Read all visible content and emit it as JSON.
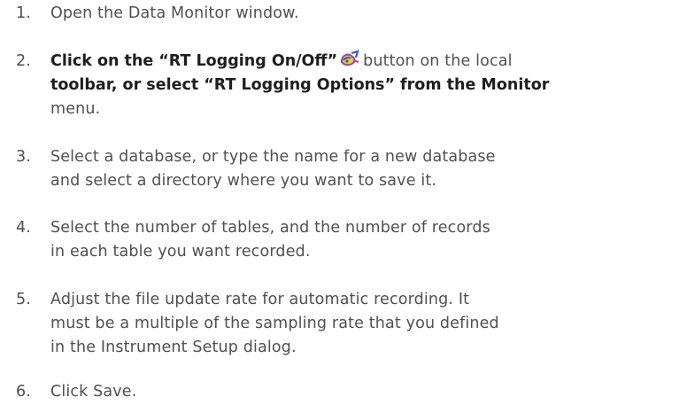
{
  "steps": [
    {
      "num": "1.",
      "text": "Open the Data Monitor window."
    },
    {
      "num": "2.",
      "line1_a": "Click on the “RT Logging On/Off”",
      "icon": "rt-logging-toolbar-icon",
      "line1_b": "button on the local",
      "line2": "toolbar, or select “RT Logging Options” from the Monitor",
      "line3": "menu."
    },
    {
      "num": "3.",
      "line1": "Select a database, or type the name for a new database",
      "line2": "and select a directory where you want to save it."
    },
    {
      "num": "4.",
      "line1": "Select the number of tables, and the number of records",
      "line2": "in each table you want recorded."
    },
    {
      "num": "5.",
      "line1": "Adjust the file update rate for automatic recording. It",
      "line2": "must be a multiple of the sampling rate that you defined",
      "line3": "in the Instrument Setup dialog."
    },
    {
      "num": "6.",
      "text": "Click Save."
    }
  ],
  "colors": {
    "text": "#505050",
    "emphasis": "#1e1e1e",
    "icon_blue": "#2b5fd9",
    "icon_purple": "#a040c0",
    "icon_yellow": "#f2d21a"
  }
}
